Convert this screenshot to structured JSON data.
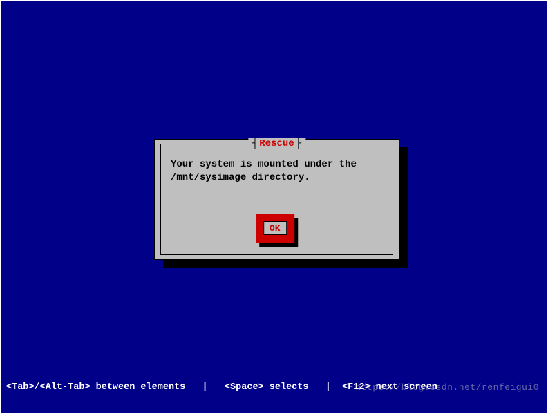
{
  "dialog": {
    "title": "Rescue",
    "title_bracket_open": "┤",
    "title_bracket_close": "├",
    "message": "Your system is mounted under the\n/mnt/sysimage directory.",
    "ok_label": "OK"
  },
  "status_bar": {
    "text": "<Tab>/<Alt-Tab> between elements   |   <Space> selects   |  <F12> next screen"
  },
  "watermark": {
    "text": "https://blog.csdn.net/renfeigui0"
  }
}
